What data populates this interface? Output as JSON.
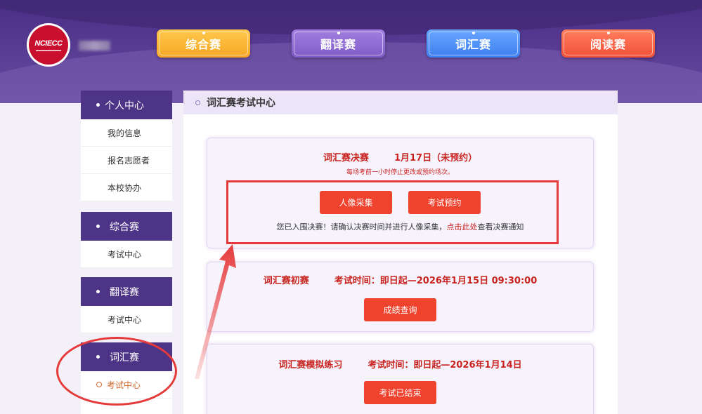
{
  "header": {
    "logo": {
      "text": "NCIECC"
    },
    "nav": [
      {
        "label": "综合赛"
      },
      {
        "label": "翻译赛"
      },
      {
        "label": "词汇赛"
      },
      {
        "label": "阅读赛"
      }
    ]
  },
  "sidebar": {
    "personal": {
      "title": "个人中心",
      "items": [
        "我的信息",
        "报名志愿者",
        "本校协办"
      ]
    },
    "comprehensive": {
      "title": "综合赛",
      "item": "考试中心"
    },
    "translation": {
      "title": "翻译赛",
      "item": "考试中心"
    },
    "vocabulary": {
      "title": "词汇赛",
      "item": "考试中心"
    }
  },
  "main": {
    "title": "词汇赛考试中心",
    "final": {
      "name": "词汇赛决赛",
      "date": "1月17日（未预约）",
      "note": "每场考前一小时停止更改或预约场次。",
      "btn_photo": "人像采集",
      "btn_reserve": "考试预约",
      "msg_prefix": "您已入围决赛！请确认决赛时间并进行人像采集，",
      "msg_link": "点击此处",
      "msg_suffix": "查看决赛通知"
    },
    "prelim": {
      "name": "词汇赛初赛",
      "time": "考试时间：即日起—2026年1月15日 09:30:00",
      "btn": "成绩查询"
    },
    "mock": {
      "name": "词汇赛模拟练习",
      "time": "考试时间：即日起—2026年1月14日",
      "btn": "考试已结束"
    }
  },
  "colors": {
    "header_purple": "#4a2f86",
    "accent_red": "#f0432e",
    "title_red": "#c8231f",
    "annotation_red": "#e63a3a"
  }
}
